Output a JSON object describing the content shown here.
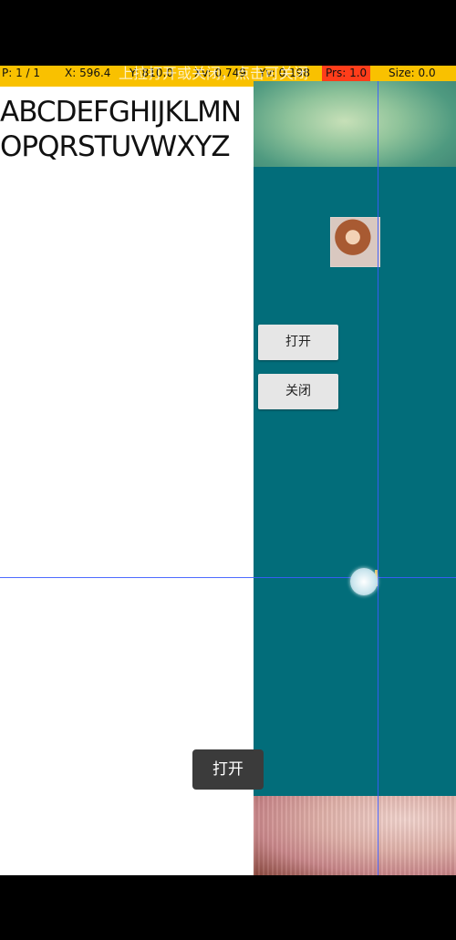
{
  "debug_bar": {
    "pointer": "P: 1 / 1",
    "x": "X: 596.4",
    "y": "Y: 810.0",
    "xv": "Xv: 0.749",
    "yv": "Yv: 0.198",
    "prs": "Prs: 1.0",
    "size": "Size: 0.0"
  },
  "ghost_title": "上拉打开或关闭，点击可关闭",
  "content": {
    "alphabet": "ABCDEFGHIJKLMNOPQRSTUVWXYZ"
  },
  "buttons": {
    "open_label": "打开",
    "close_label": "关闭"
  },
  "toast": {
    "text": "打开"
  },
  "colors": {
    "debug_bar": "#f9c100",
    "pressure_highlight": "#ff3d1a",
    "panel_teal": "#026d7a",
    "crosshair": "#3b5bff",
    "toast_bg": "#3b3b3b"
  }
}
